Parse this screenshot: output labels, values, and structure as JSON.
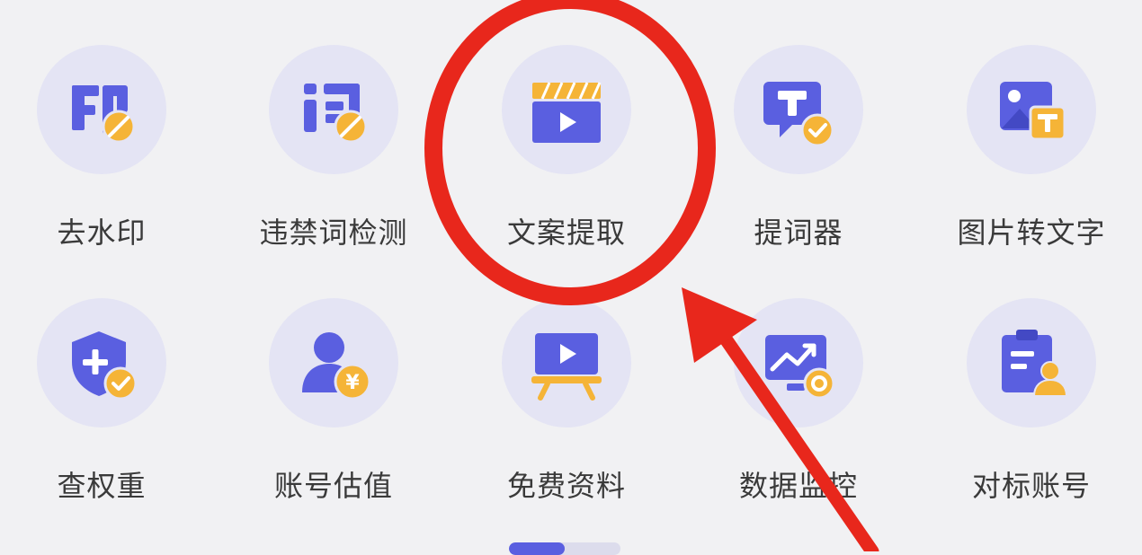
{
  "colors": {
    "primary": "#5a5fe0",
    "accent": "#f5b437",
    "circle_bg": "#e4e4f4",
    "annotation": "#e8271c"
  },
  "tools_row1": [
    {
      "label": "去水印",
      "icon": "watermark-remove-icon"
    },
    {
      "label": "违禁词检测",
      "icon": "banned-word-check-icon"
    },
    {
      "label": "文案提取",
      "icon": "video-clapper-icon"
    },
    {
      "label": "提词器",
      "icon": "teleprompter-icon"
    },
    {
      "label": "图片转文字",
      "icon": "image-to-text-icon"
    }
  ],
  "tools_row2": [
    {
      "label": "查权重",
      "icon": "shield-check-icon"
    },
    {
      "label": "账号估值",
      "icon": "account-value-icon"
    },
    {
      "label": "免费资料",
      "icon": "presentation-board-icon"
    },
    {
      "label": "数据监控",
      "icon": "data-monitor-icon"
    },
    {
      "label": "对标账号",
      "icon": "benchmark-account-icon"
    }
  ],
  "annotation": {
    "highlighted_tool": "文案提取",
    "shapes": [
      "red-circle",
      "red-arrow"
    ]
  },
  "pager": {
    "pages": 2,
    "active": 1
  }
}
